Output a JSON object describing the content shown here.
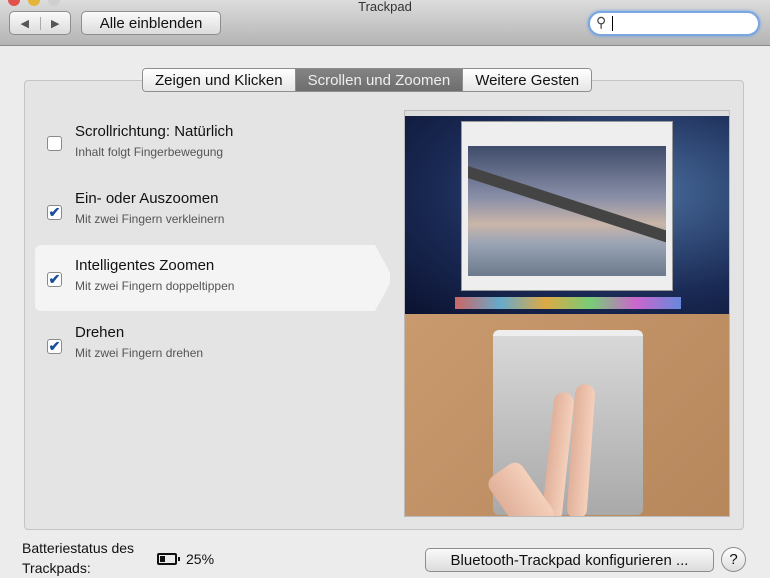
{
  "window": {
    "title": "Trackpad"
  },
  "toolbar": {
    "back": "◀",
    "forward": "▶",
    "show_all": "Alle einblenden",
    "search_placeholder": ""
  },
  "tabs": [
    {
      "label": "Zeigen und Klicken"
    },
    {
      "label": "Scrollen und Zoomen",
      "active": true
    },
    {
      "label": "Weitere Gesten"
    }
  ],
  "options": [
    {
      "title": "Scrollrichtung: Natürlich",
      "subtitle": "Inhalt folgt Fingerbewegung",
      "checked": false,
      "mark": ""
    },
    {
      "title": "Ein- oder Auszoomen",
      "subtitle": "Mit zwei Fingern verkleinern",
      "checked": true,
      "mark": "✔"
    },
    {
      "title": "Intelligentes Zoomen",
      "subtitle": "Mit zwei Fingern doppeltippen",
      "checked": true,
      "mark": "✔"
    },
    {
      "title": "Drehen",
      "subtitle": "Mit zwei Fingern drehen",
      "checked": true,
      "mark": "✔"
    }
  ],
  "footer": {
    "battery_label": "Batteriestatus des Trackpads:",
    "battery_percent": "25%",
    "configure_button": "Bluetooth-Trackpad konfigurieren ...",
    "help": "?"
  }
}
